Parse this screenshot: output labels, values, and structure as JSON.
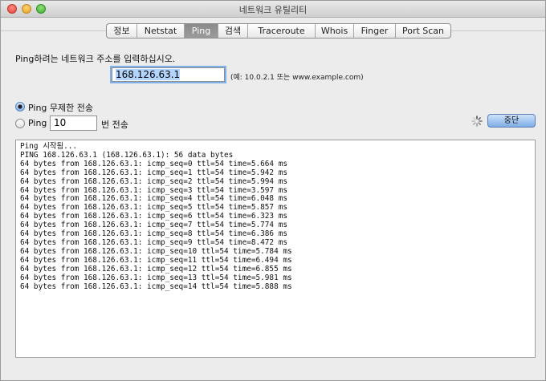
{
  "window": {
    "title": "네트워크 유틸리티"
  },
  "tabs": [
    {
      "label": "정보",
      "active": false
    },
    {
      "label": "Netstat",
      "active": false
    },
    {
      "label": "Ping",
      "active": true
    },
    {
      "label": "검색",
      "active": false
    },
    {
      "label": "Traceroute",
      "active": false
    },
    {
      "label": "Whois",
      "active": false
    },
    {
      "label": "Finger",
      "active": false
    },
    {
      "label": "Port Scan",
      "active": false
    }
  ],
  "ping": {
    "prompt": "Ping하려는 네트워크 주소를 입력하십시오.",
    "address_value": "168.126.63.1",
    "address_hint": "(예: 10.0.2.1 또는 www.example.com)",
    "option_unlimited": "Ping 무제한 전송",
    "option_count_prefix": "Ping",
    "count_value": "10",
    "option_count_suffix": "번 전송",
    "selected_option": "unlimited",
    "stop_button": "중단"
  },
  "output": {
    "lines": [
      "Ping 시작됨...",
      "",
      "PING 168.126.63.1 (168.126.63.1): 56 data bytes",
      "64 bytes from 168.126.63.1: icmp_seq=0 ttl=54 time=5.664 ms",
      "64 bytes from 168.126.63.1: icmp_seq=1 ttl=54 time=5.942 ms",
      "64 bytes from 168.126.63.1: icmp_seq=2 ttl=54 time=5.994 ms",
      "64 bytes from 168.126.63.1: icmp_seq=3 ttl=54 time=3.597 ms",
      "64 bytes from 168.126.63.1: icmp_seq=4 ttl=54 time=6.048 ms",
      "64 bytes from 168.126.63.1: icmp_seq=5 ttl=54 time=5.857 ms",
      "64 bytes from 168.126.63.1: icmp_seq=6 ttl=54 time=6.323 ms",
      "64 bytes from 168.126.63.1: icmp_seq=7 ttl=54 time=5.774 ms",
      "64 bytes from 168.126.63.1: icmp_seq=8 ttl=54 time=6.386 ms",
      "64 bytes from 168.126.63.1: icmp_seq=9 ttl=54 time=8.472 ms",
      "64 bytes from 168.126.63.1: icmp_seq=10 ttl=54 time=5.784 ms",
      "64 bytes from 168.126.63.1: icmp_seq=11 ttl=54 time=6.494 ms",
      "64 bytes from 168.126.63.1: icmp_seq=12 ttl=54 time=6.855 ms",
      "64 bytes from 168.126.63.1: icmp_seq=13 ttl=54 time=5.981 ms",
      "64 bytes from 168.126.63.1: icmp_seq=14 ttl=54 time=5.888 ms"
    ]
  },
  "icons": {
    "close": "close-icon",
    "minimize": "minimize-icon",
    "zoom": "zoom-icon",
    "spinner": "spinner-icon"
  },
  "colors": {
    "accent": "#7eaee6",
    "selection": "#b3d4fc",
    "active_tab": "#8a8a8a"
  }
}
